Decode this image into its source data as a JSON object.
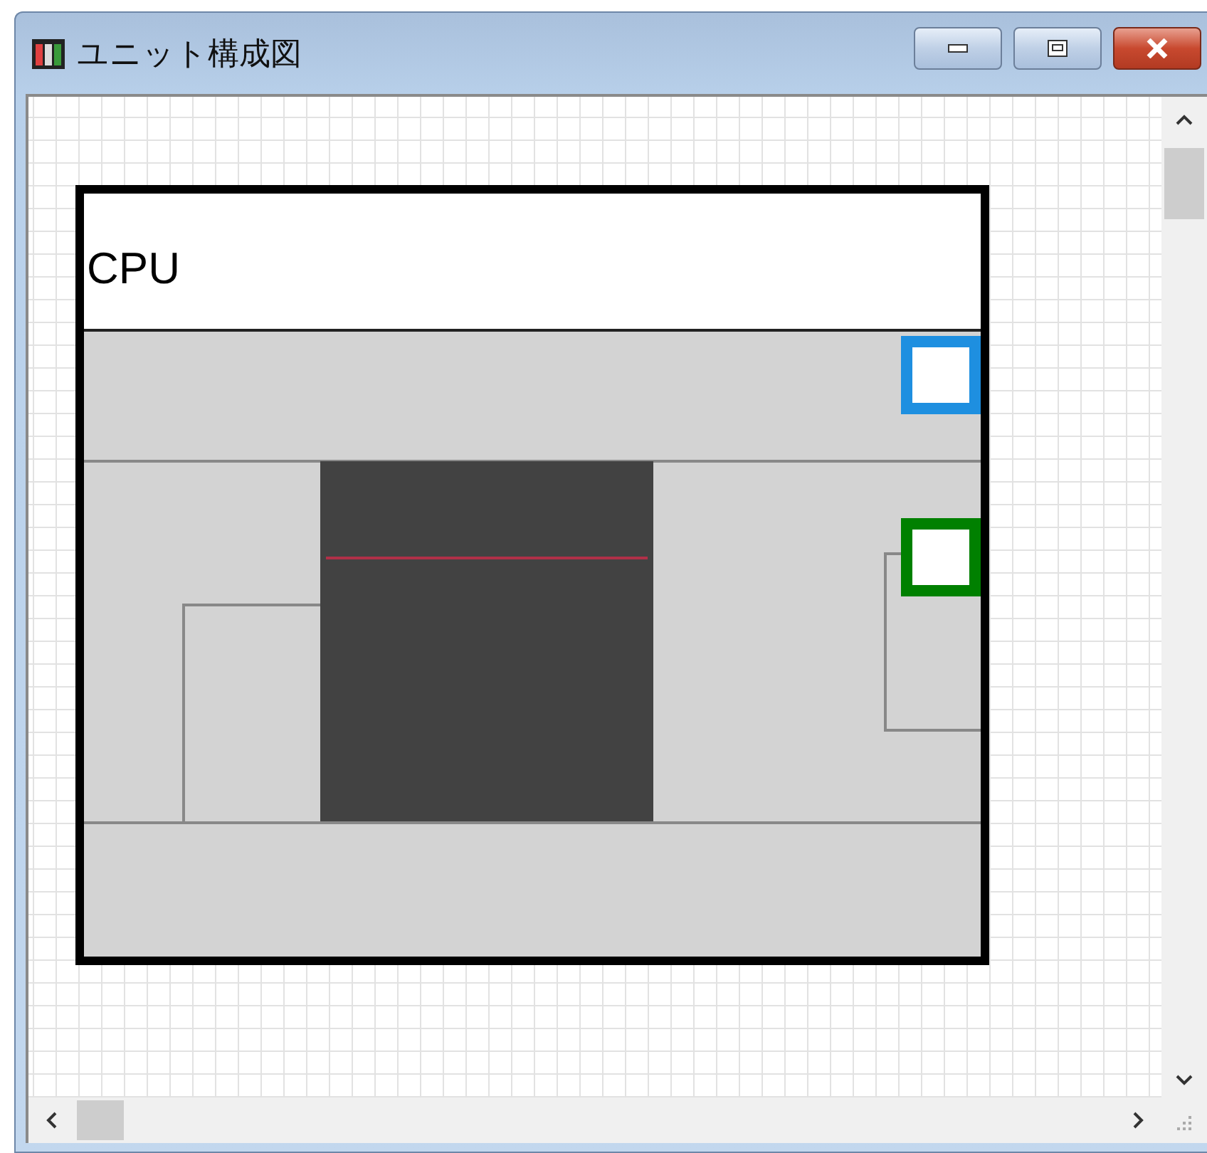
{
  "window": {
    "title": "ユニット構成図"
  },
  "unit": {
    "label": "CPU",
    "indicators": [
      {
        "color": "#1e8fe0"
      },
      {
        "color": "#008000"
      }
    ]
  }
}
